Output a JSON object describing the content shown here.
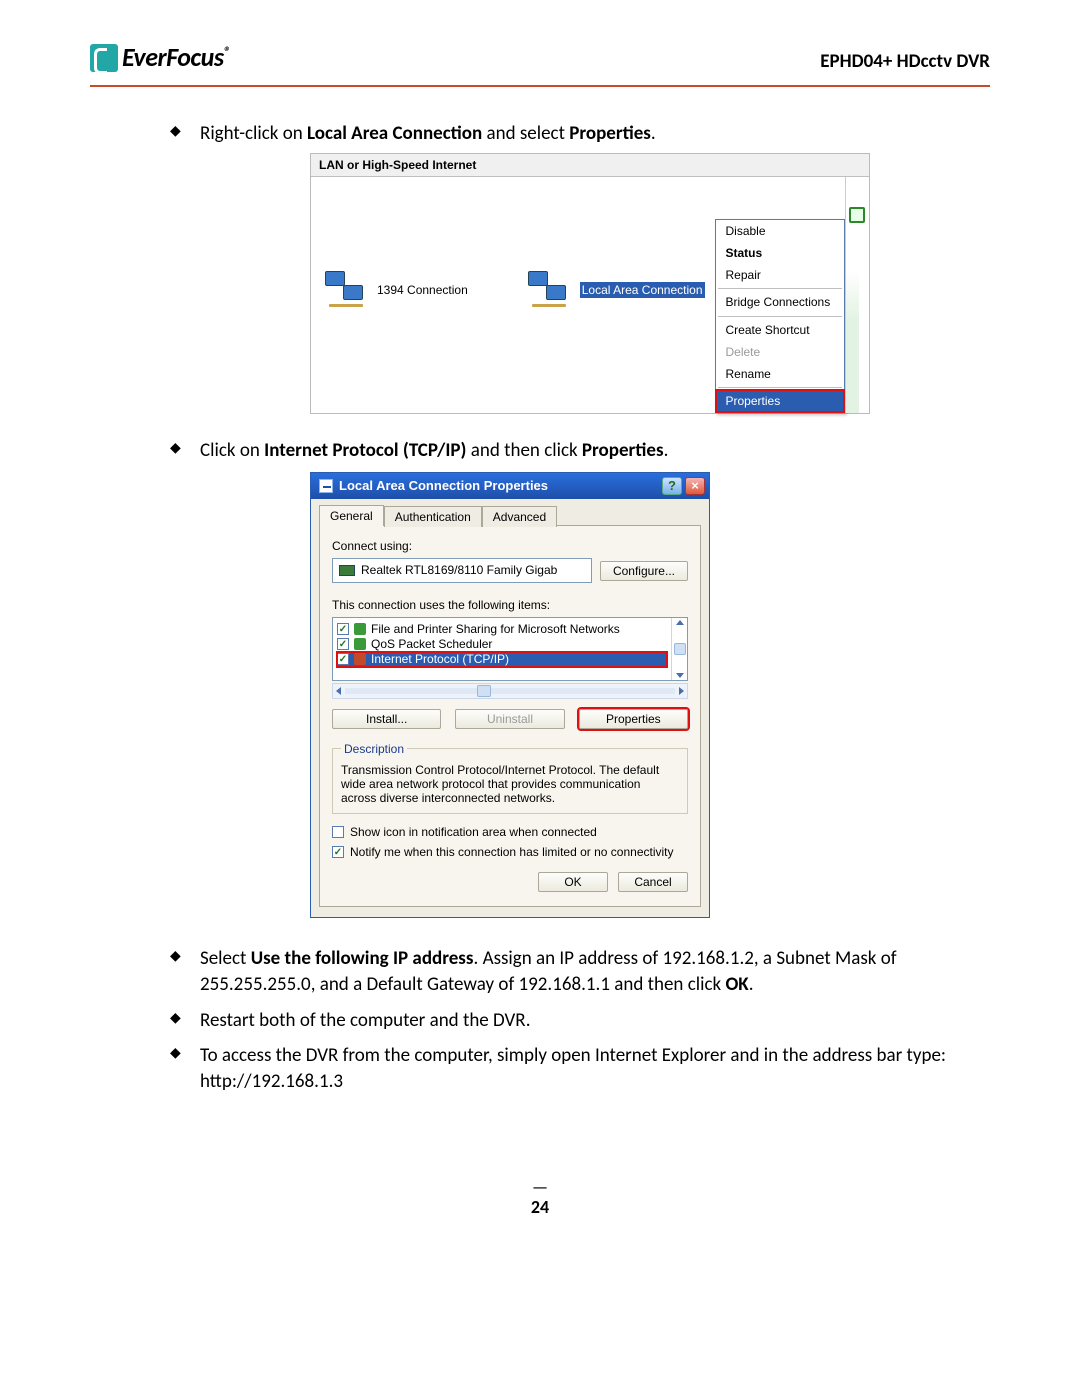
{
  "header": {
    "brand": "EverFocus",
    "model": "EPHD04+  HDcctv DVR"
  },
  "steps": {
    "s1_pre": "Right-click on ",
    "s1_b1": "Local Area Connection",
    "s1_mid": " and select ",
    "s1_b2": "Properties",
    "s1_post": ".",
    "s2_pre": "Click on ",
    "s2_b1": "Internet Protocol (TCP/IP)",
    "s2_mid": " and then click ",
    "s2_b2": "Properties",
    "s2_post": ".",
    "s3_pre": "Select ",
    "s3_b1": "Use the following IP address",
    "s3_mid": ". Assign an IP address of 192.168.1.2, a Subnet Mask of 255.255.255.0, and a Default Gateway of 192.168.1.1 and then click ",
    "s3_b2": "OK",
    "s3_post": ".",
    "s4": "Restart both of the computer and the DVR.",
    "s5": "To access the DVR from the computer, simply open Internet Explorer and in the address bar type: http://192.168.1.3"
  },
  "ss1": {
    "heading": "LAN or High-Speed Internet",
    "item1": "1394 Connection",
    "item2": "Local Area Connection",
    "menu": {
      "disable": "Disable",
      "status": "Status",
      "repair": "Repair",
      "bridge": "Bridge Connections",
      "shortcut": "Create Shortcut",
      "delete": "Delete",
      "rename": "Rename",
      "properties": "Properties"
    }
  },
  "ss2": {
    "title": "Local Area Connection Properties",
    "tabs": {
      "general": "General",
      "auth": "Authentication",
      "adv": "Advanced"
    },
    "connect_using_label": "Connect using:",
    "adapter": "Realtek RTL8169/8110 Family Gigab",
    "configure": "Configure...",
    "items_label": "This connection uses the following items:",
    "items": {
      "fps": "File and Printer Sharing for Microsoft Networks",
      "qos": "QoS Packet Scheduler",
      "tcpip": "Internet Protocol (TCP/IP)"
    },
    "buttons": {
      "install": "Install...",
      "uninstall": "Uninstall",
      "properties": "Properties"
    },
    "desc_legend": "Description",
    "description": "Transmission Control Protocol/Internet Protocol. The default wide area network protocol that provides communication across diverse interconnected networks.",
    "chk_show": "Show icon in notification area when connected",
    "chk_notify": "Notify me when this connection has limited or no connectivity",
    "ok": "OK",
    "cancel": "Cancel"
  },
  "page_number": "24"
}
